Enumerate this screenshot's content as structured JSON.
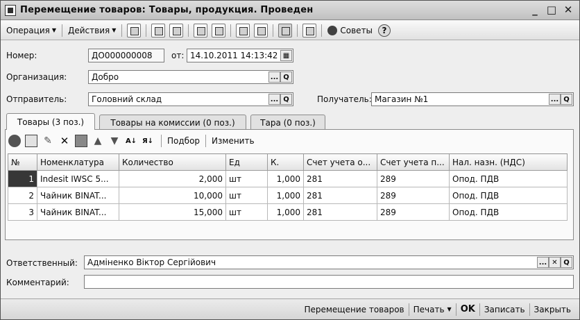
{
  "window": {
    "title": "Перемещение товаров: Товары, продукция. Проведен"
  },
  "toolbar": {
    "operation_label": "Операция",
    "actions_label": "Действия",
    "advice_label": "Советы"
  },
  "form": {
    "number_label": "Номер:",
    "number_value": "ДО000000008",
    "date_label": "от:",
    "date_value": "14.10.2011 14:13:42",
    "org_label": "Организация:",
    "org_value": "Добро",
    "sender_label": "Отправитель:",
    "sender_value": "Головний склад",
    "receiver_label": "Получатель:",
    "receiver_value": "Магазин №1"
  },
  "tabs": [
    {
      "label": "Товары (3 поз.)"
    },
    {
      "label": "Товары на комиссии (0 поз.)"
    },
    {
      "label": "Тара (0 поз.)"
    }
  ],
  "grid_toolbar": {
    "select_label": "Подбор",
    "change_label": "Изменить"
  },
  "table": {
    "headers": [
      "№",
      "Номенклатура",
      "Количество",
      "Ед",
      "К.",
      "Счет учета о...",
      "Счет учета п...",
      "Нал. назн. (НДС)"
    ],
    "rows": [
      {
        "n": "1",
        "item": "Indesit IWSC 5...",
        "qty": "2,000",
        "unit": "шт",
        "k": "1,000",
        "acc_from": "281",
        "acc_to": "289",
        "vat": "Опод. ПДВ"
      },
      {
        "n": "2",
        "item": "Чайник BINAT...",
        "qty": "10,000",
        "unit": "шт",
        "k": "1,000",
        "acc_from": "281",
        "acc_to": "289",
        "vat": "Опод. ПДВ"
      },
      {
        "n": "3",
        "item": "Чайник BINAT...",
        "qty": "15,000",
        "unit": "шт",
        "k": "1,000",
        "acc_from": "281",
        "acc_to": "289",
        "vat": "Опод. ПДВ"
      }
    ]
  },
  "footer": {
    "responsible_label": "Ответственный:",
    "responsible_value": "Адміненко Віктор Сергійович",
    "comment_label": "Комментарий:",
    "comment_value": ""
  },
  "bottombar": {
    "move_label": "Перемещение товаров",
    "print_label": "Печать",
    "ok_label": "OK",
    "save_label": "Записать",
    "close_label": "Закрыть"
  }
}
